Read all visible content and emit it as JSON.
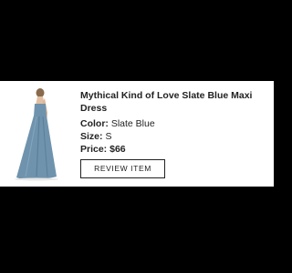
{
  "item": {
    "title": "Mythical Kind of Love Slate Blue Maxi Dress",
    "color_label": "Color:",
    "color_value": "Slate Blue",
    "size_label": "Size:",
    "size_value": "S",
    "price_label": "Price:",
    "price_value": "$66",
    "dress_color": "#6f93ad"
  },
  "actions": {
    "review_label": "REVIEW ITEM"
  }
}
